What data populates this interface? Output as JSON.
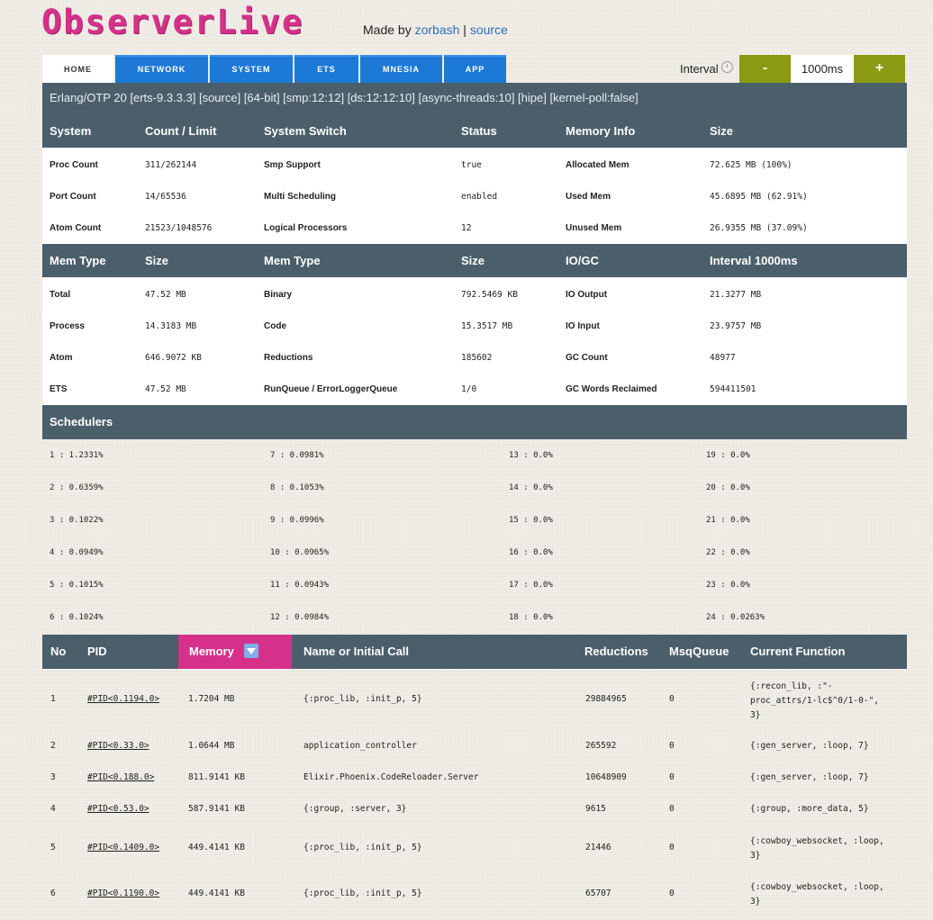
{
  "header": {
    "logo": "ObserverLive",
    "made_by": "Made by",
    "author": "zorbash",
    "separator": "|",
    "source": "source"
  },
  "tabs": [
    "HOME",
    "NETWORK",
    "SYSTEM",
    "ETS",
    "MNESIA",
    "APP"
  ],
  "interval": {
    "label": "Interval",
    "minus": "-",
    "value": "1000ms",
    "plus": "+"
  },
  "otp": "Erlang/OTP 20 [erts-9.3.3.3] [source] [64-bit] [smp:12:12] [ds:12:12:10] [async-threads:10] [hipe] [kernel-poll:false]",
  "system": {
    "headers": [
      "System",
      "Count / Limit",
      "System Switch",
      "Status",
      "Memory Info",
      "Size"
    ],
    "rows": [
      [
        "Proc Count",
        "311/262144",
        "Smp Support",
        "true",
        "Allocated Mem",
        "72.625 MB (100%)"
      ],
      [
        "Port Count",
        "14/65536",
        "Multi Scheduling",
        "enabled",
        "Used Mem",
        "45.6895 MB (62.91%)"
      ],
      [
        "Atom Count",
        "21523/1048576",
        "Logical Processors",
        "12",
        "Unused Mem",
        "26.9355 MB (37.09%)"
      ]
    ]
  },
  "memory": {
    "headers": [
      "Mem Type",
      "Size",
      "Mem Type",
      "Size",
      "IO/GC",
      "Interval 1000ms"
    ],
    "rows": [
      [
        "Total",
        "47.52 MB",
        "Binary",
        "792.5469 KB",
        "IO Output",
        "21.3277 MB"
      ],
      [
        "Process",
        "14.3183 MB",
        "Code",
        "15.3517 MB",
        "IO Input",
        "23.9757 MB"
      ],
      [
        "Atom",
        "646.9072 KB",
        "Reductions",
        "185602",
        "GC Count",
        "48977"
      ],
      [
        "ETS",
        "47.52 MB",
        "RunQueue / ErrorLoggerQueue",
        "1/0",
        "GC Words Reclaimed",
        "594411501"
      ]
    ]
  },
  "schedulers": {
    "title": "Schedulers",
    "columns": [
      [
        "1 : 1.2331%",
        "2 : 0.6359%",
        "3 : 0.1022%",
        "4 : 0.0949%",
        "5 : 0.1015%",
        "6 : 0.1024%"
      ],
      [
        "7 : 0.0981%",
        "8 : 0.1053%",
        "9 : 0.0996%",
        "10 : 0.0965%",
        "11 : 0.0943%",
        "12 : 0.0984%"
      ],
      [
        "13 : 0.0%",
        "14 : 0.0%",
        "15 : 0.0%",
        "16 : 0.0%",
        "17 : 0.0%",
        "18 : 0.0%"
      ],
      [
        "19 : 0.0%",
        "20 : 0.0%",
        "21 : 0.0%",
        "22 : 0.0%",
        "23 : 0.0%",
        "24 : 0.0263%"
      ]
    ]
  },
  "processes": {
    "headers": [
      "No",
      "PID",
      "Memory",
      "Name or Initial Call",
      "Reductions",
      "MsqQueue",
      "Current Function"
    ],
    "rows": [
      [
        "1",
        "#PID<0.1194.0>",
        "1.7204 MB",
        "{:proc_lib, :init_p, 5}",
        "29884965",
        "0",
        "{:recon_lib, :\"-\nproc_attrs/1-lc$^0/1-0-\",\n3}"
      ],
      [
        "2",
        "#PID<0.33.0>",
        "1.0644 MB",
        "application_controller",
        "265592",
        "0",
        "{:gen_server, :loop, 7}"
      ],
      [
        "3",
        "#PID<0.188.0>",
        "811.9141 KB",
        "Elixir.Phoenix.CodeReloader.Server",
        "10648909",
        "0",
        "{:gen_server, :loop, 7}"
      ],
      [
        "4",
        "#PID<0.53.0>",
        "587.9141 KB",
        "{:group, :server, 3}",
        "9615",
        "0",
        "{:group, :more_data, 5}"
      ],
      [
        "5",
        "#PID<0.1409.0>",
        "449.4141 KB",
        "{:proc_lib, :init_p, 5}",
        "21446",
        "0",
        "{:cowboy_websocket, :loop,\n3}"
      ],
      [
        "6",
        "#PID<0.1190.0>",
        "449.4141 KB",
        "{:proc_lib, :init_p, 5}",
        "65707",
        "0",
        "{:cowboy_websocket, :loop,\n3}"
      ]
    ]
  },
  "colors": {
    "header_bg": "#4b5f6b",
    "tab_blue": "#1d79d6",
    "logo_pink": "#d6318a",
    "olive": "#8a9a12"
  }
}
